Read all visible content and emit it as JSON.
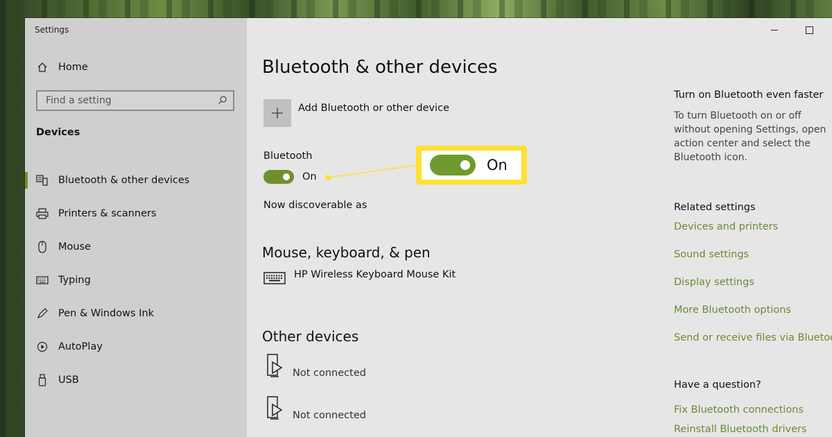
{
  "window": {
    "title": "Settings"
  },
  "sidebar": {
    "home": "Home",
    "search": {
      "placeholder": "Find a setting"
    },
    "section": "Devices",
    "items": [
      {
        "label": "Bluetooth & other devices",
        "icon": "bluetooth-devices-icon",
        "active": true
      },
      {
        "label": "Printers & scanners",
        "icon": "printer-icon"
      },
      {
        "label": "Mouse",
        "icon": "mouse-icon"
      },
      {
        "label": "Typing",
        "icon": "keyboard-icon"
      },
      {
        "label": "Pen & Windows Ink",
        "icon": "pen-icon"
      },
      {
        "label": "AutoPlay",
        "icon": "autoplay-icon"
      },
      {
        "label": "USB",
        "icon": "usb-icon"
      }
    ]
  },
  "main": {
    "title": "Bluetooth & other devices",
    "add_device": "Add Bluetooth or other device",
    "bluetooth": {
      "label": "Bluetooth",
      "state": "On"
    },
    "discoverable": "Now discoverable as",
    "mouse_keyboard_pen": {
      "heading": "Mouse, keyboard, & pen",
      "device": "HP Wireless Keyboard Mouse Kit"
    },
    "other_devices": {
      "heading": "Other devices",
      "items": [
        {
          "status": "Not connected"
        },
        {
          "status": "Not connected"
        }
      ]
    }
  },
  "callout": {
    "state": "On"
  },
  "right": {
    "tip_heading": "Turn on Bluetooth even faster",
    "tip_text": "To turn Bluetooth on or off without opening Settings, open action center and select the Bluetooth icon.",
    "related_heading": "Related settings",
    "related_links": [
      "Devices and printers",
      "Sound settings",
      "Display settings",
      "More Bluetooth options",
      "Send or receive files via Bluetooth"
    ],
    "question_heading": "Have a question?",
    "question_links": [
      "Fix Bluetooth connections",
      "Reinstall Bluetooth drivers"
    ]
  },
  "colors": {
    "accent": "#6f8f2e",
    "link": "#6b8a34",
    "callout": "#ffe033"
  }
}
